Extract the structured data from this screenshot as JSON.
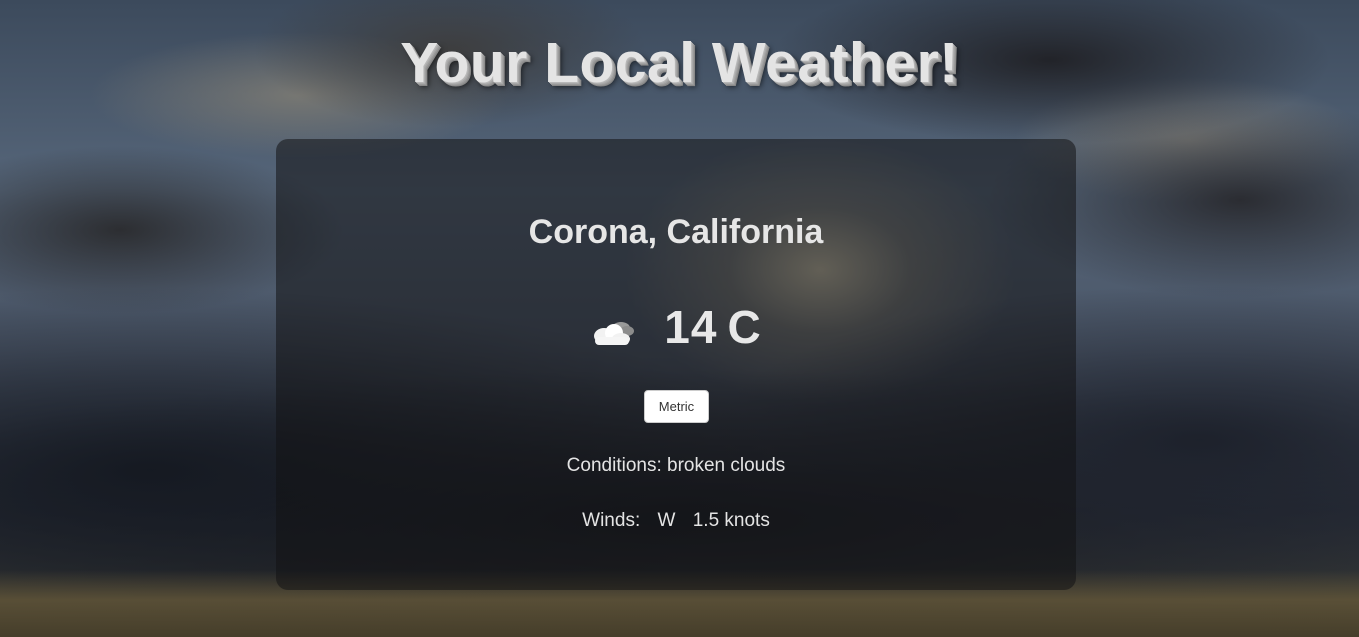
{
  "header": {
    "title": "Your Local Weather!"
  },
  "weather": {
    "location": "Corona, California",
    "icon": "broken-clouds-icon",
    "temperature": "14",
    "temperature_unit": "C",
    "units_button_label": "Metric",
    "conditions_label": "Conditions:",
    "conditions_value": "broken clouds",
    "winds_label": "Winds:",
    "wind_direction": "W",
    "wind_speed": "1.5 knots"
  },
  "colors": {
    "card_background": "#121214",
    "text": "#e4e4e4",
    "button_background": "#ffffff"
  }
}
